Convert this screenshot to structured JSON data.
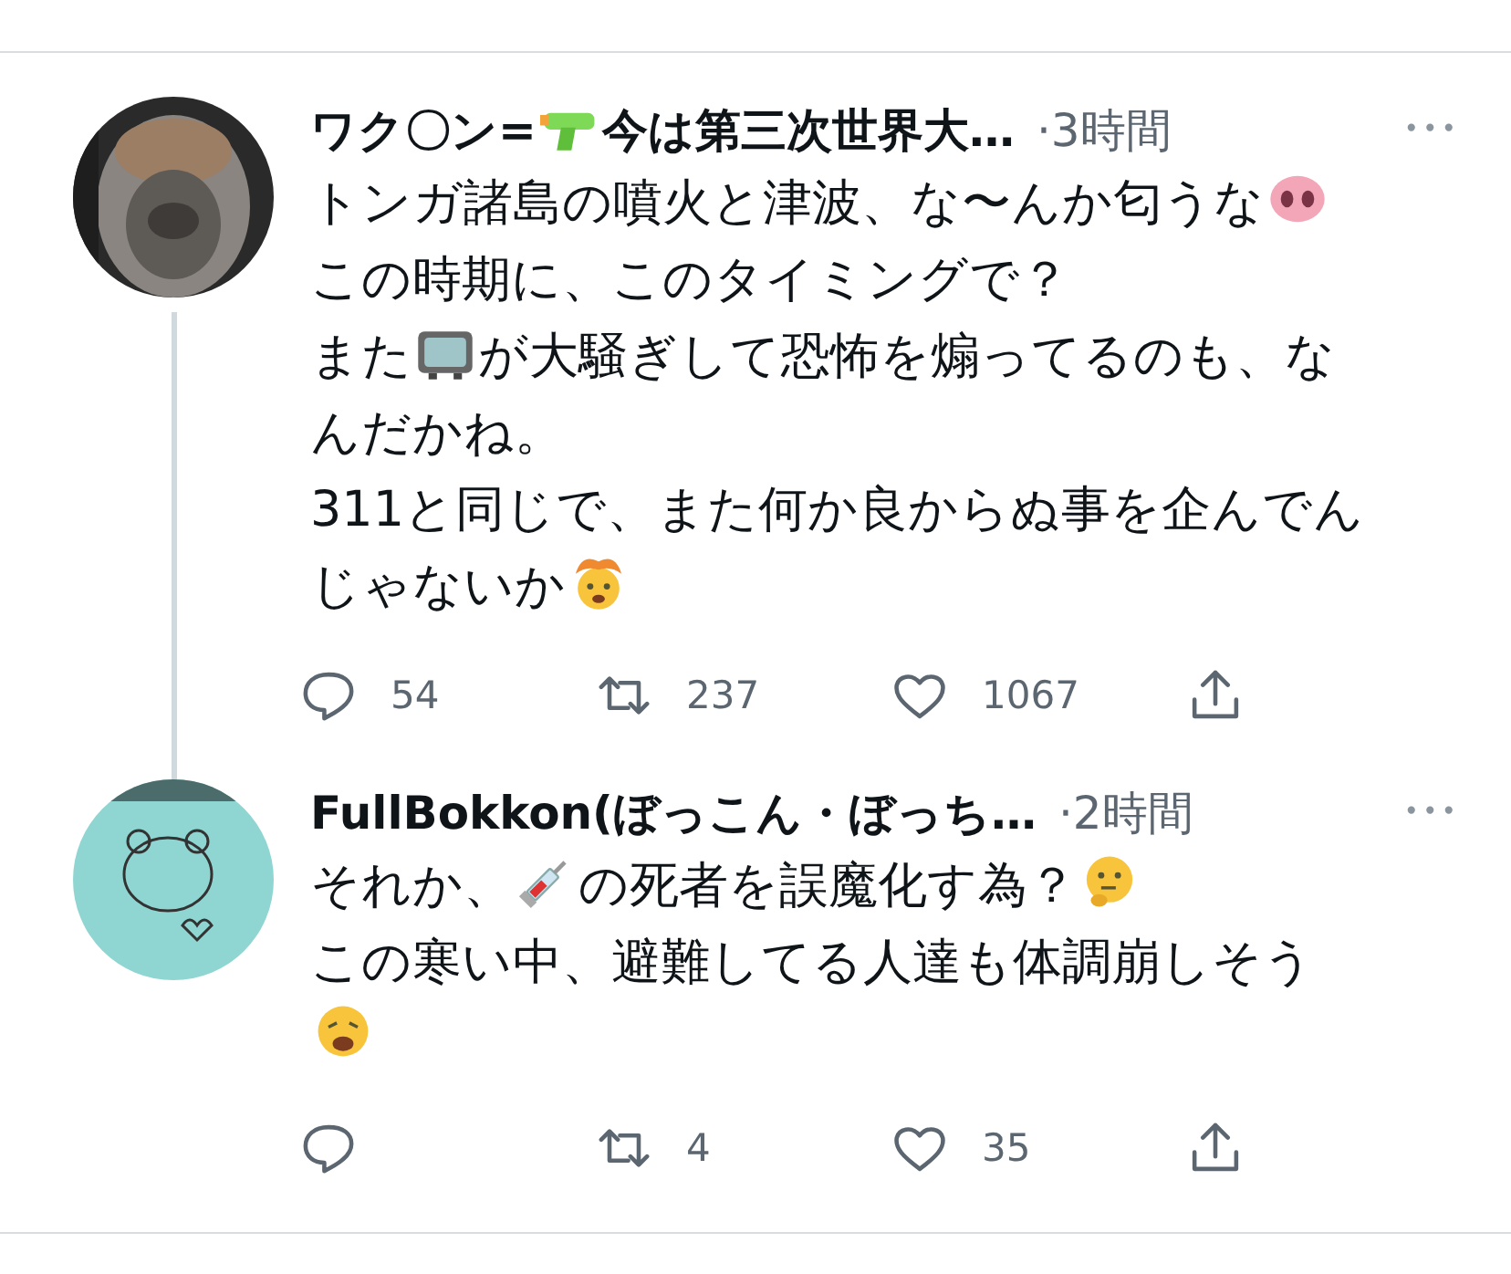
{
  "tweets": [
    {
      "name": [
        {
          "kind": "text",
          "text": "ワク〇ン="
        },
        {
          "kind": "pistol"
        },
        {
          "kind": "text",
          "text": " 今は第三次世界大…"
        }
      ],
      "time": "·3時間",
      "more": "•••",
      "body": [
        [
          {
            "kind": "text",
            "text": "トンガ諸島の噴火と津波、な〜んか匂うな"
          },
          {
            "kind": "pig"
          }
        ],
        [
          {
            "kind": "text",
            "text": "この時期に、このタイミングで？"
          }
        ],
        [
          {
            "kind": "text",
            "text": "また"
          },
          {
            "kind": "tv"
          },
          {
            "kind": "text",
            "text": "が大騒ぎして恐怖を煽ってるのも、な"
          }
        ],
        [
          {
            "kind": "text",
            "text": "んだかね。"
          }
        ],
        [
          {
            "kind": "text",
            "text": "311と同じで、また何か良からぬ事を企んでん"
          }
        ],
        [
          {
            "kind": "text",
            "text": "じゃないか"
          },
          {
            "kind": "exploding"
          }
        ]
      ],
      "replies": "54",
      "retweets": "237",
      "likes": "1067"
    },
    {
      "name": [
        {
          "kind": "text",
          "text": "FullBokkon(ぼっこん・ぼっち…"
        }
      ],
      "time": "·2時間",
      "more": "•••",
      "body": [
        [
          {
            "kind": "text",
            "text": "それか、"
          },
          {
            "kind": "syringe"
          },
          {
            "kind": "text",
            "text": "の死者を誤魔化す為？"
          },
          {
            "kind": "thinking"
          }
        ],
        [
          {
            "kind": "text",
            "text": "この寒い中、避難してる人達も体調崩しそう"
          }
        ],
        [
          {
            "kind": "weary"
          }
        ]
      ],
      "retweets": "4",
      "likes": "35"
    }
  ]
}
